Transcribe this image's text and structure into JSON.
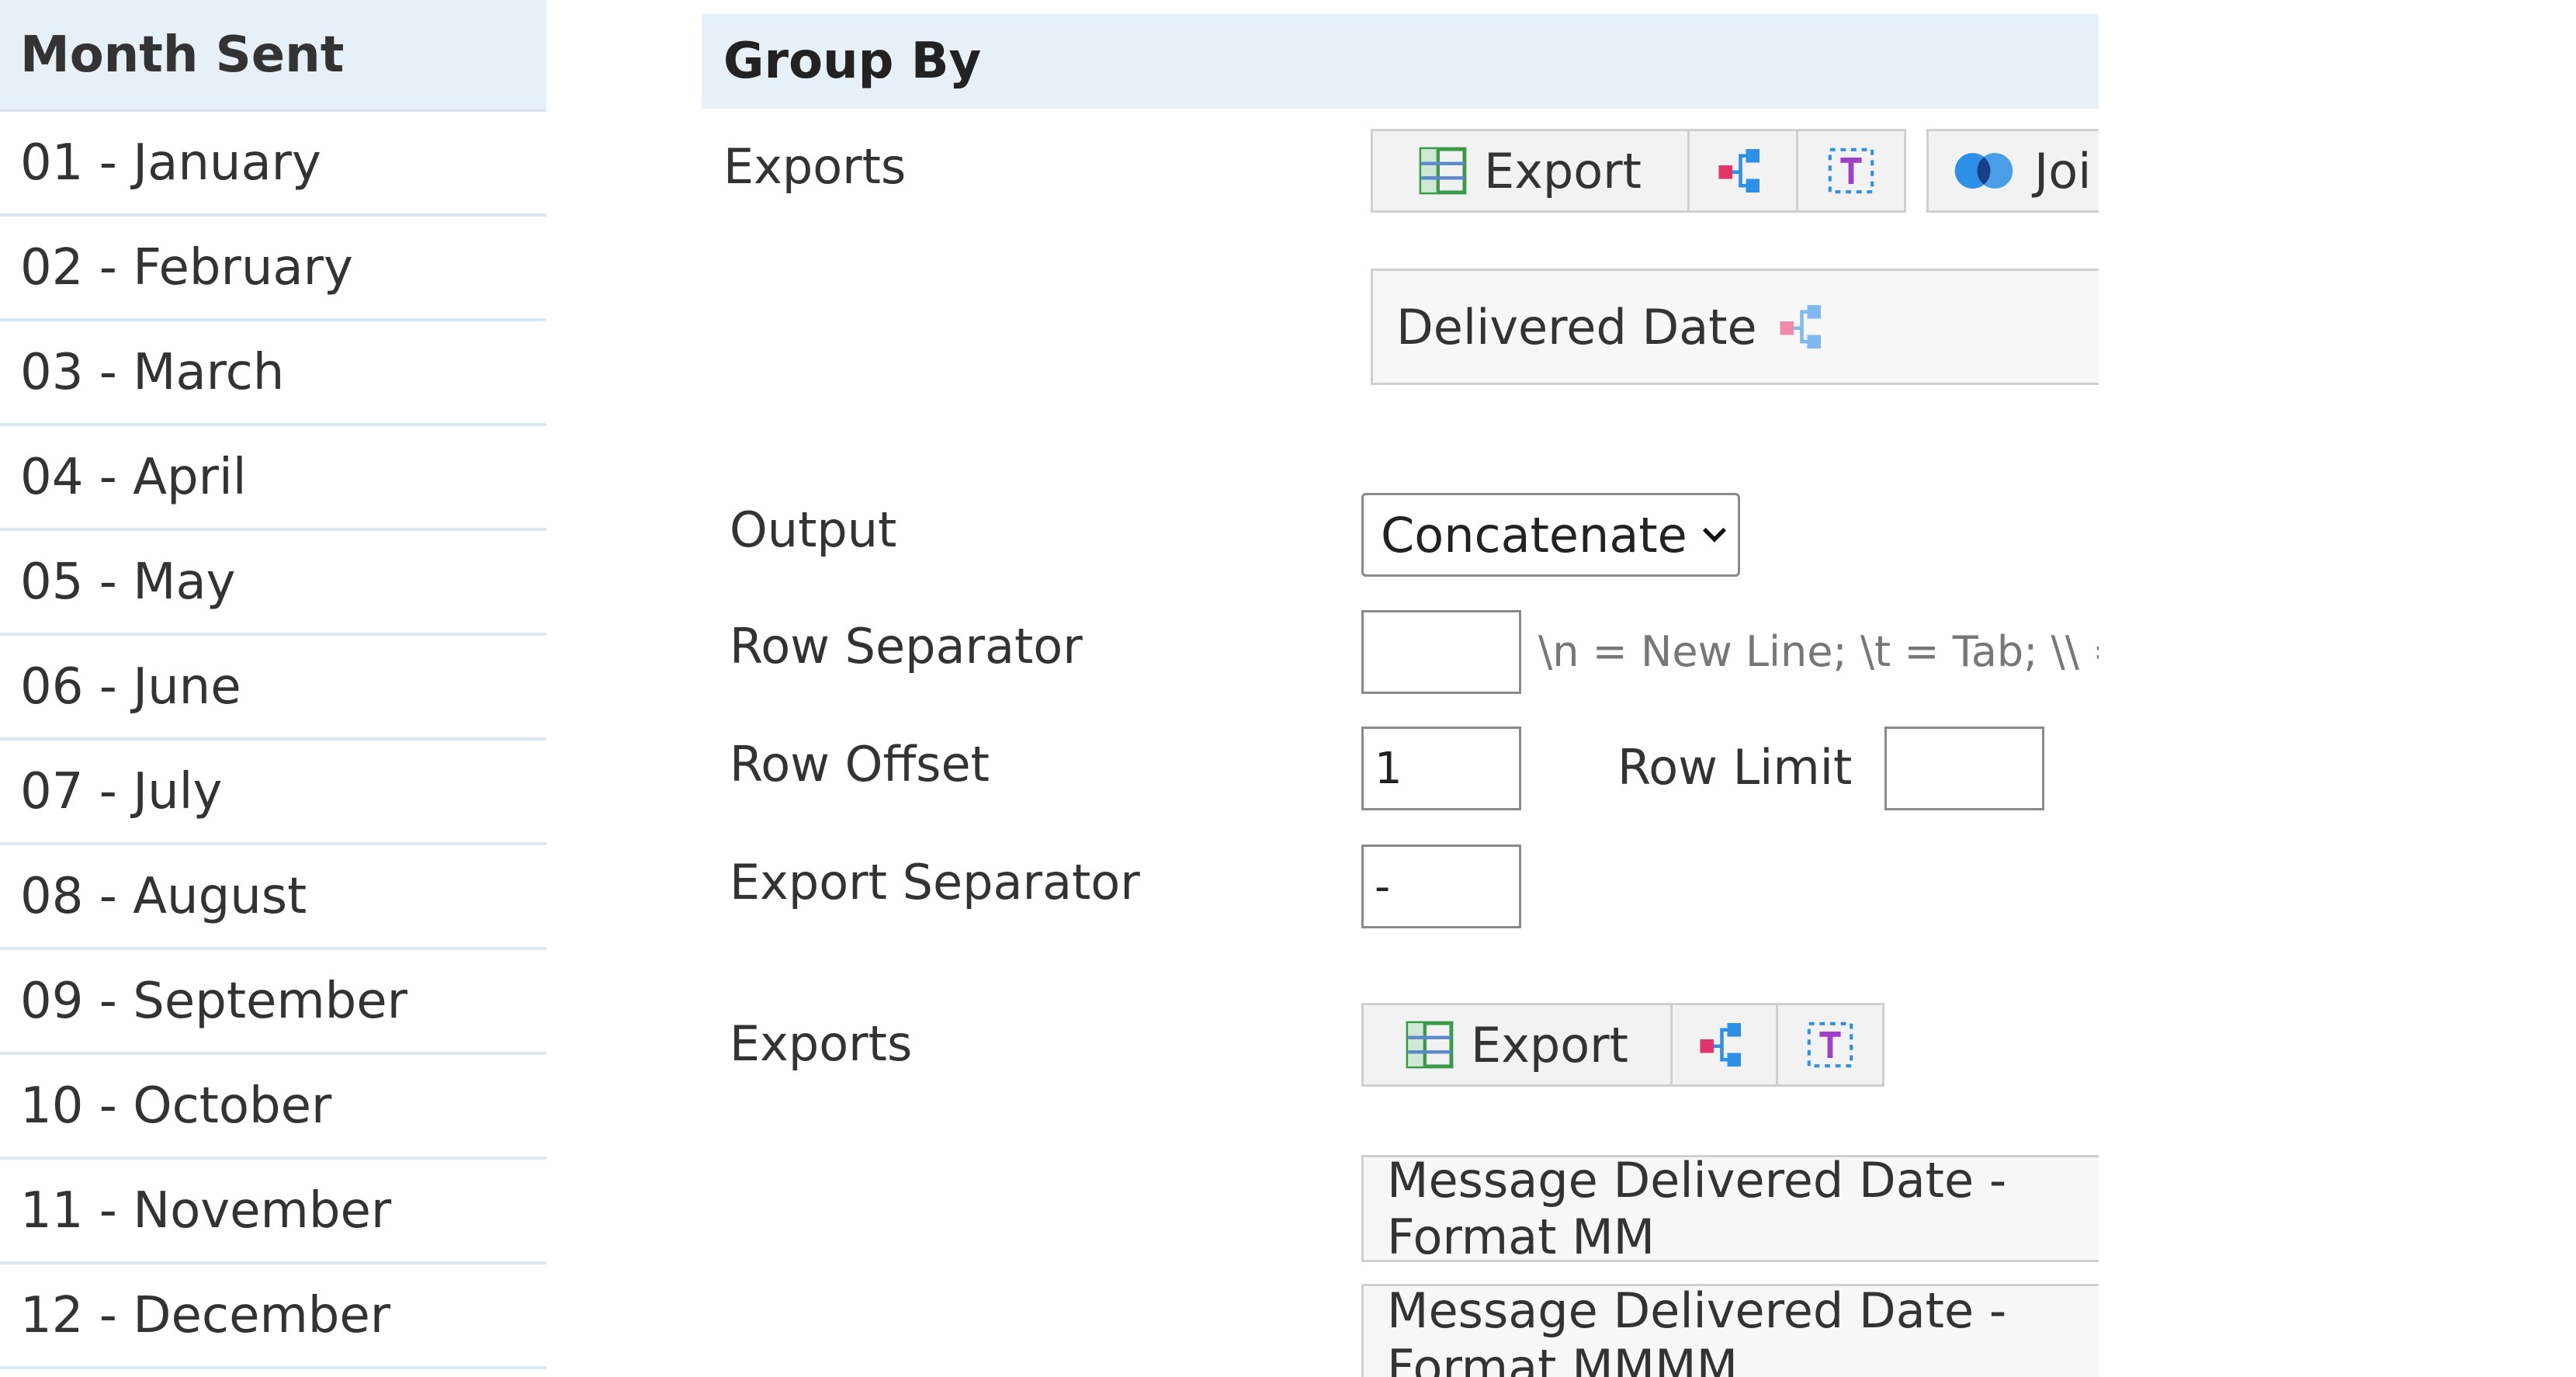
{
  "month_table": {
    "header": "Month Sent",
    "rows": [
      "01 - January",
      "02 - February",
      "03 - March",
      "04 - April",
      "05 - May",
      "06 - June",
      "07 - July",
      "08 - August",
      "09 - September",
      "10 - October",
      "11 - November",
      "12 - December"
    ]
  },
  "group_by": {
    "title": "Group By",
    "exports_label": "Exports",
    "export_button": "Export",
    "join_button": "Joi",
    "source_field": "Delivered Date",
    "output_label": "Output",
    "output_value": "Concatenate",
    "row_separator_label": "Row Separator",
    "row_separator_value": "",
    "row_separator_hint": "\\n = New Line; \\t = Tab; \\\\ = Escaped Backslash",
    "row_offset_label": "Row Offset",
    "row_offset_value": "1",
    "row_limit_label": "Row Limit",
    "row_limit_value": "",
    "export_separator_label": "Export Separator",
    "export_separator_value": "-",
    "exports2_label": "Exports",
    "export2_button": "Export",
    "result_fields": [
      "Message Delivered Date - Format MM",
      "Message Delivered Date - Format MMMM"
    ]
  },
  "colors": {
    "header_bg": "#e8f0f7",
    "icon_pink": "#e2336b",
    "icon_blue": "#2d8fe6",
    "icon_purple": "#a040c8",
    "icon_green": "#3a9a4a"
  },
  "icons": [
    "table-grid-icon",
    "share-tree-icon",
    "text-t-icon",
    "join-circles-icon",
    "chevron-down-icon"
  ]
}
